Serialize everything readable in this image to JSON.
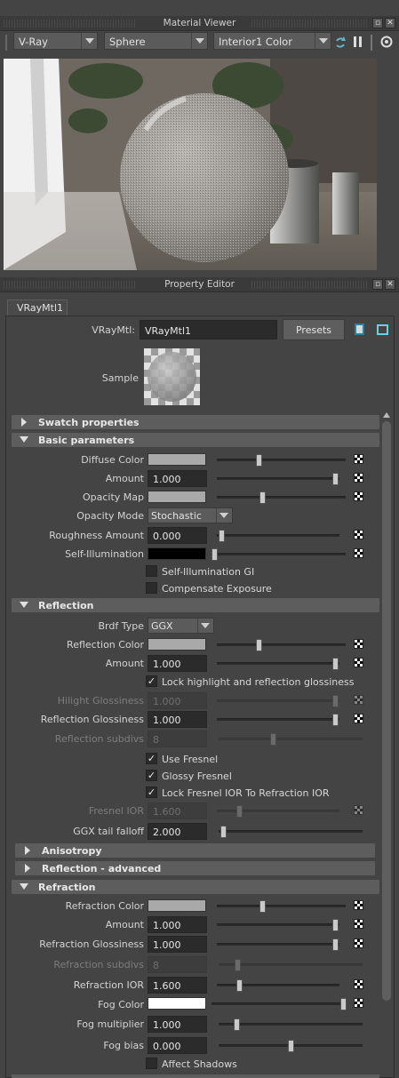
{
  "material_viewer": {
    "title": "Material Viewer",
    "renderer": "V-Ray",
    "geometry": "Sphere",
    "environment": "Interior1 Color"
  },
  "property_editor": {
    "title": "Property Editor",
    "tab": "VRayMtl1",
    "node_label": "VRayMtl:",
    "node_name": "VRayMtl1",
    "presets_label": "Presets",
    "sample_label": "Sample"
  },
  "sections": {
    "swatch_properties": "Swatch properties",
    "basic_parameters": "Basic parameters",
    "reflection": "Reflection",
    "anisotropy": "Anisotropy",
    "reflection_advanced": "Reflection - advanced",
    "refraction": "Refraction"
  },
  "basic": {
    "diffuse_color_label": "Diffuse Color",
    "diffuse_color": "#a9a9a9",
    "amount_label": "Amount",
    "amount": "1.000",
    "amount_level": 1.0,
    "opacity_map_label": "Opacity Map",
    "opacity_map_color": "#a9a9a9",
    "opacity_mode_label": "Opacity Mode",
    "opacity_mode": "Stochastic",
    "roughness_label": "Roughness Amount",
    "roughness": "0.000",
    "roughness_level": 0.0,
    "self_illum_label": "Self-Illumination",
    "self_illum_color": "#000000",
    "self_illum_gi": "Self-Illumination GI",
    "compensate_exposure": "Compensate Exposure"
  },
  "reflection": {
    "brdf_type_label": "Brdf Type",
    "brdf_type": "GGX",
    "reflection_color_label": "Reflection Color",
    "reflection_color": "#a9a9a9",
    "amount_label": "Amount",
    "amount": "1.000",
    "lock_highlight": "Lock highlight and reflection glossiness",
    "hilight_glossiness_label": "Hilight Glossiness",
    "hilight_glossiness": "1.000",
    "reflection_glossiness_label": "Reflection Glossiness",
    "reflection_glossiness": "1.000",
    "reflection_subdivs_label": "Reflection subdivs",
    "reflection_subdivs": "8",
    "use_fresnel": "Use Fresnel",
    "glossy_fresnel": "Glossy Fresnel",
    "lock_fresnel_ior": "Lock Fresnel IOR To Refraction IOR",
    "fresnel_ior_label": "Fresnel IOR",
    "fresnel_ior": "1.600",
    "ggx_tail_label": "GGX tail falloff",
    "ggx_tail": "2.000"
  },
  "refraction": {
    "refraction_color_label": "Refraction Color",
    "refraction_color": "#a9a9a9",
    "amount_label": "Amount",
    "amount": "1.000",
    "refraction_glossiness_label": "Refraction Glossiness",
    "refraction_glossiness": "1.000",
    "refraction_subdivs_label": "Refraction subdivs",
    "refraction_subdivs": "8",
    "refraction_ior_label": "Refraction IOR",
    "refraction_ior": "1.600",
    "fog_color_label": "Fog Color",
    "fog_color": "#ffffff",
    "fog_multiplier_label": "Fog multiplier",
    "fog_multiplier": "1.000",
    "fog_bias_label": "Fog bias",
    "fog_bias": "0.000",
    "affect_shadows": "Affect Shadows"
  }
}
